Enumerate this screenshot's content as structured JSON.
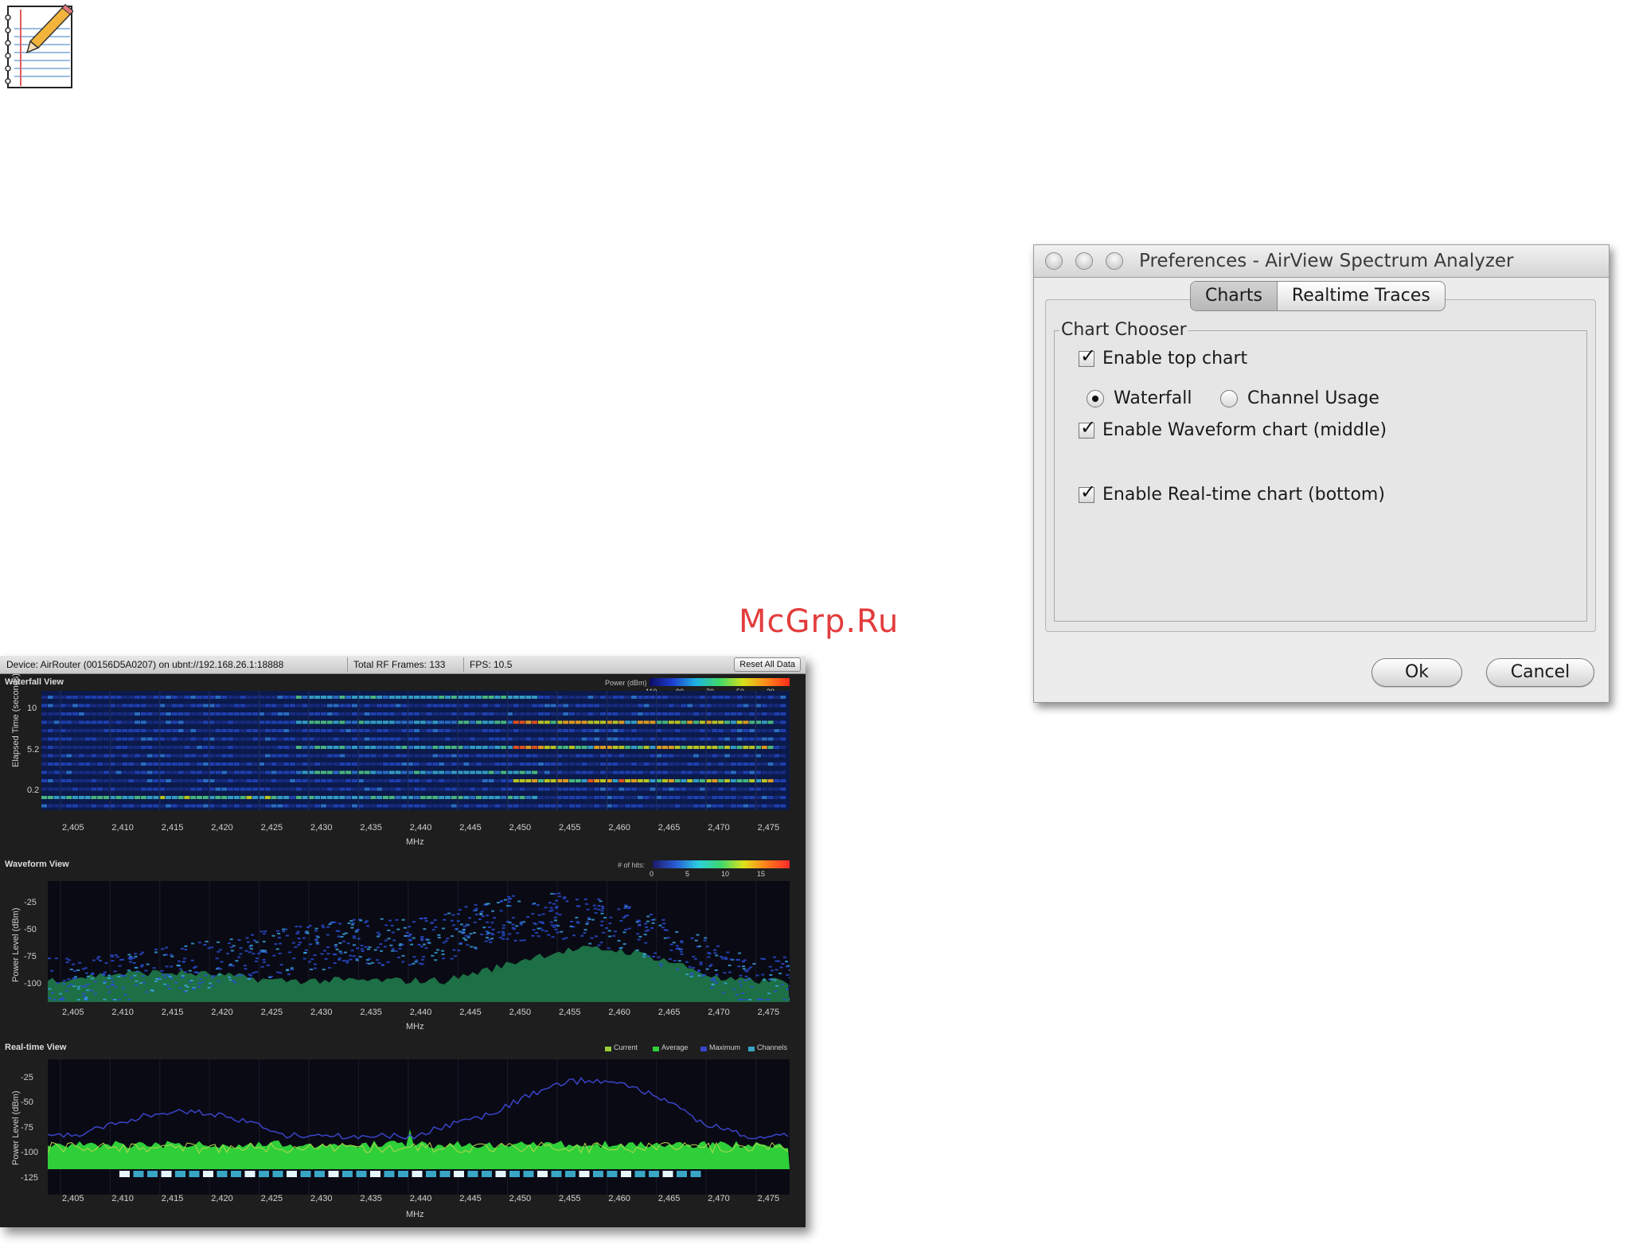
{
  "watermark": "McGrp.Ru",
  "analyzer": {
    "device": "Device: AirRouter (00156D5A0207) on ubnt://192.168.26.1:18888",
    "frames": "Total RF Frames: 133",
    "fps": "FPS: 10.5",
    "reset_button": "Reset All Data",
    "x_ticks": [
      "2,405",
      "2,410",
      "2,415",
      "2,420",
      "2,425",
      "2,430",
      "2,435",
      "2,440",
      "2,445",
      "2,450",
      "2,455",
      "2,460",
      "2,465",
      "2,470",
      "2,475"
    ],
    "x_axis_label": "MHz",
    "waterfall": {
      "title": "Waterfall View",
      "y_label": "Elapsed Time (seconds)",
      "y_ticks": [
        "10",
        "5.2",
        "0.2"
      ],
      "legend_title": "Power (dBm)",
      "legend_ticks": [
        "-110",
        "-90",
        "-70",
        "-50",
        "-30"
      ]
    },
    "waveform": {
      "title": "Waveform View",
      "y_label": "Power Level (dBm)",
      "y_ticks": [
        "-25",
        "-50",
        "-75",
        "-100"
      ],
      "legend_title": "# of hits:",
      "legend_ticks": [
        "0",
        "5",
        "10",
        "15"
      ]
    },
    "realtime": {
      "title": "Real-time View",
      "y_label": "Power Level (dBm)",
      "y_ticks": [
        "-25",
        "-50",
        "-75",
        "-100",
        "-125"
      ],
      "legend": [
        "Current",
        "Average",
        "Maximum",
        "Channels"
      ]
    },
    "colors": {
      "background": "#1e1e1e",
      "plot": "#0a0a14",
      "trace_avg": "#2fcf3a",
      "trace_max": "#3a44c8",
      "channels": "#3aa6c6"
    }
  },
  "prefs": {
    "window_title": "Preferences - AirView Spectrum Analyzer",
    "tabs": [
      "Charts",
      "Realtime Traces"
    ],
    "active_tab": "Charts",
    "group_title": "Chart Chooser",
    "enable_top": "Enable top chart",
    "radio_waterfall": "Waterfall",
    "radio_channel_usage": "Channel Usage",
    "selected_radio": "Waterfall",
    "enable_waveform": "Enable Waveform chart (middle)",
    "enable_realtime": "Enable Real-time chart (bottom)",
    "checked": {
      "top": true,
      "waveform": true,
      "realtime": true
    },
    "ok_button": "Ok",
    "cancel_button": "Cancel"
  }
}
